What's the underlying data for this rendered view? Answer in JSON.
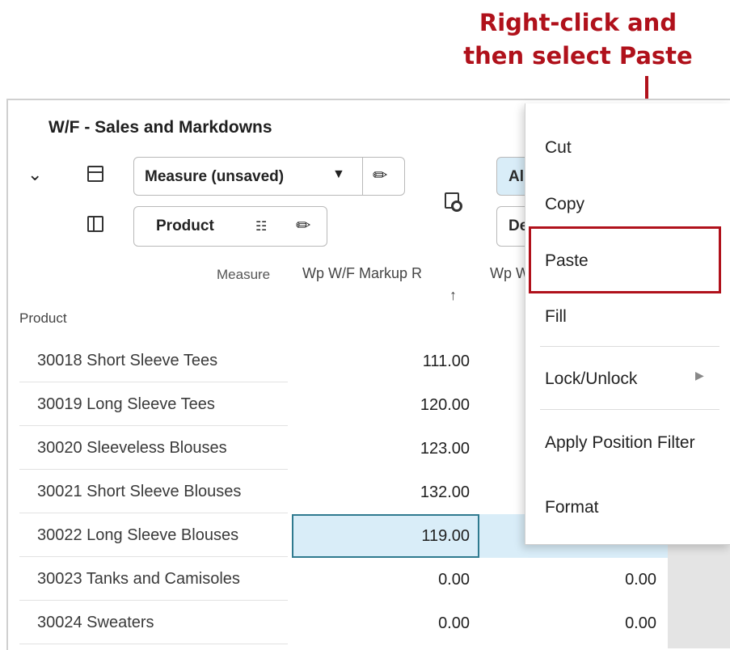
{
  "callout": {
    "line1": "Right-click and",
    "line2": "then select Paste",
    "color": "#b0111b"
  },
  "view": {
    "title": "W/F - Sales and Markdowns",
    "measure_selector": "Measure (unsaved)",
    "product_selector": "Product",
    "right_selector_top": "Al",
    "right_selector_bottom": "De"
  },
  "grid": {
    "measure_label": "Measure",
    "product_label": "Product",
    "columns": [
      "Wp W/F Markup R",
      "Wp W"
    ],
    "sort_indicator": "↑",
    "rows": [
      {
        "product": "30018 Short Sleeve Tees",
        "v1": "111.00",
        "v2": ""
      },
      {
        "product": "30019 Long Sleeve Tees",
        "v1": "120.00",
        "v2": ""
      },
      {
        "product": "30020 Sleeveless Blouses",
        "v1": "123.00",
        "v2": ""
      },
      {
        "product": "30021 Short Sleeve Blouses",
        "v1": "132.00",
        "v2": ""
      },
      {
        "product": "30022 Long Sleeve Blouses",
        "v1": "119.00",
        "v2": ""
      },
      {
        "product": "30023 Tanks and Camisoles",
        "v1": "0.00",
        "v2": "0.00"
      },
      {
        "product": "30024 Sweaters",
        "v1": "0.00",
        "v2": "0.00"
      }
    ],
    "selected_row_index": 4,
    "selection_color": "#d9edf8"
  },
  "context_menu": {
    "items": [
      "Cut",
      "Copy",
      "Paste",
      "Fill",
      "Lock/Unlock",
      "Apply Position Filter",
      "Format"
    ],
    "submenu_arrow": "▶",
    "highlighted": "Paste"
  },
  "icons": [
    "chevron-down-icon",
    "table-layout-icon",
    "panel-layout-icon",
    "caret-down-icon",
    "pencil-icon",
    "hierarchy-icon",
    "sheet-settings-icon",
    "sort-ascending-icon",
    "submenu-arrow-icon"
  ]
}
